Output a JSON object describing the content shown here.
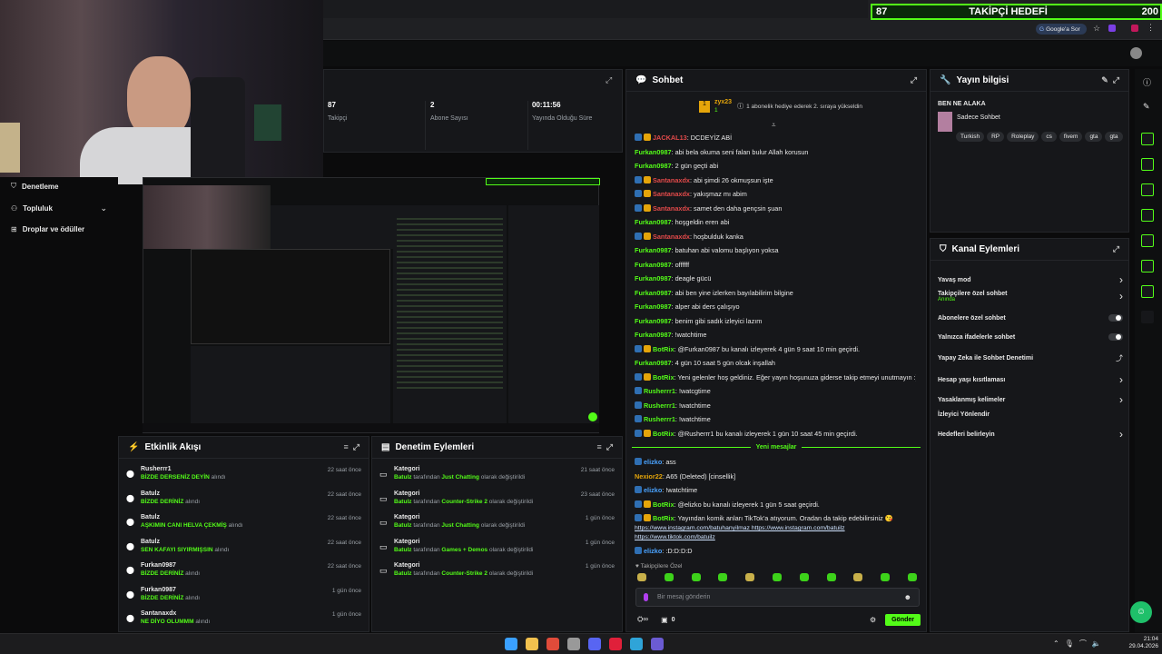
{
  "browser": {
    "goal_num": "87",
    "goal_title": "TAKİPÇİ HEDEFİ",
    "goal_max": "200",
    "google_btn": "Google'a Sor"
  },
  "stats": [
    {
      "value": "87",
      "label": "Takipçi"
    },
    {
      "value": "2",
      "label": "Abone Sayısı"
    },
    {
      "value": "00:11:56",
      "label": "Yayında Olduğu Süre"
    }
  ],
  "nav": {
    "items": [
      {
        "label": "Denetleme"
      },
      {
        "label": "Topluluk"
      },
      {
        "label": "Droplar ve ödüller"
      }
    ]
  },
  "chat": {
    "title": "Sohbet",
    "gifter": "zyx23",
    "gifter_count": "1",
    "gift_text": "1 abonelik hediye ederek 2. sıraya yükseldin",
    "lines": [
      {
        "user": "JACKAL13",
        "color": "#e24a4a",
        "text": ": DCDEYİZ ABİ",
        "badges": 2
      },
      {
        "user": "Furkan0987",
        "color": "#53fc18",
        "text": ": abi bela okuma seni falan bulur Allah korusun",
        "badges": 0
      },
      {
        "user": "Furkan0987",
        "color": "#53fc18",
        "text": ": 2 gün geçti abi",
        "badges": 0
      },
      {
        "user": "Santanaxdx",
        "color": "#e24a4a",
        "text": ": abi şimdi 26 okmuşsun işte",
        "badges": 2
      },
      {
        "user": "Santanaxdx",
        "color": "#e24a4a",
        "text": ": yakışmaz mı abim",
        "badges": 2
      },
      {
        "user": "Santanaxdx",
        "color": "#e24a4a",
        "text": ": samet den daha gençsin şuan",
        "badges": 2
      },
      {
        "user": "Furkan0987",
        "color": "#53fc18",
        "text": ": hoşgeldin eren abi",
        "badges": 0
      },
      {
        "user": "Santanaxdx",
        "color": "#e24a4a",
        "text": ": hoşbulduk kanka",
        "badges": 2
      },
      {
        "user": "Furkan0987",
        "color": "#53fc18",
        "text": ": batuhan abi valomu başlıyon yoksa",
        "badges": 0
      },
      {
        "user": "Furkan0987",
        "color": "#53fc18",
        "text": ": offffff",
        "badges": 0
      },
      {
        "user": "Furkan0987",
        "color": "#53fc18",
        "text": ": deagle gücü",
        "badges": 0
      },
      {
        "user": "Furkan0987",
        "color": "#53fc18",
        "text": ": abi ben yine izlerken bayılabilirim bilgine",
        "badges": 0
      },
      {
        "user": "Furkan0987",
        "color": "#53fc18",
        "text": ": alper abi ders çalışıyo",
        "badges": 0
      },
      {
        "user": "Furkan0987",
        "color": "#53fc18",
        "text": ": benim gibi sadık izleyici lazım",
        "badges": 0
      },
      {
        "user": "Furkan0987",
        "color": "#53fc18",
        "text": ": !watchtime",
        "badges": 0
      },
      {
        "user": "BotRix",
        "color": "#53fc18",
        "text": ": @Furkan0987 bu kanalı izleyerek 4 gün 9 saat 10 min geçirdi.",
        "badges": 2
      },
      {
        "user": "Furkan0987",
        "color": "#53fc18",
        "text": ": 4 gün 10 saat 5 gün olcak inşallah",
        "badges": 0
      },
      {
        "user": "BotRix",
        "color": "#53fc18",
        "text": ": Yeni gelenler hoş geldiniz. Eğer yayın hoşunuza giderse takip etmeyi unutmayın :)",
        "badges": 2
      },
      {
        "user": "Rusherrr1",
        "color": "#53fc18",
        "text": ": !watcgtime",
        "badges": 1
      },
      {
        "user": "Rusherrr1",
        "color": "#53fc18",
        "text": ": !watchtime",
        "badges": 1
      },
      {
        "user": "Rusherrr1",
        "color": "#53fc18",
        "text": ": !watchtime",
        "badges": 1
      },
      {
        "user": "BotRix",
        "color": "#53fc18",
        "text": ": @Rusherrr1 bu kanalı izleyerek 1 gün 10 saat 45 min geçirdi.",
        "badges": 2
      }
    ],
    "new_messages": "Yeni mesajlar",
    "lines2": [
      {
        "user": "elizko",
        "color": "#4aa3ff",
        "text": ": ass",
        "badges": 1
      },
      {
        "user": "Nexior22",
        "color": "#e5a50a",
        "text": ": A65 (Deleted) [cinsellik]",
        "badges": 0
      },
      {
        "user": "elizko",
        "color": "#4aa3ff",
        "text": ": !watchtime",
        "badges": 1
      },
      {
        "user": "BotRix",
        "color": "#53fc18",
        "text": ": @elizko bu kanalı izleyerek 1 gün 5 saat geçirdi.",
        "badges": 2
      },
      {
        "user": "BotRix",
        "color": "#53fc18",
        "text": ": Yayından komik anları TikTok'a atıyorum. Oradan da takip edebilirsiniz 😘",
        "badges": 2
      }
    ],
    "links": [
      "https://www.instagram.com/batuhanyilmaz https://www.instagram.com/batuilz",
      "https://www.tiktok.com/batuilz"
    ],
    "last": {
      "user": "elizko",
      "text": ": :D:D:D:D"
    },
    "followers_only": "Takipçilere Özel",
    "placeholder": "Bir mesaj gönderin",
    "count": "0",
    "send": "Gönder"
  },
  "stream_info": {
    "title": "Yayın bilgisi",
    "stream_title": "BEN NE ALAKA",
    "category": "Sadece Sohbet",
    "tags": [
      "Turkish",
      "RP",
      "Roleplay",
      "cs",
      "fivem",
      "gta",
      "gta"
    ]
  },
  "channel_actions": {
    "title": "Kanal Eylemleri",
    "items": [
      {
        "label": "Yavaş mod",
        "sub": "",
        "control": "chevron"
      },
      {
        "label": "Takipçilere özel sohbet",
        "sub": "Anında",
        "control": "chevron"
      },
      {
        "label": "Abonelere özel sohbet",
        "sub": "",
        "control": "toggle"
      },
      {
        "label": "Yalnızca ifadelerle sohbet",
        "sub": "",
        "control": "toggle"
      },
      {
        "label": "Yapay Zeka ile Sohbet Denetimi",
        "sub": "",
        "control": "ext"
      },
      {
        "label": "Hesap yaşı kısıtlaması",
        "sub": "",
        "control": "chevron"
      },
      {
        "label": "Yasaklanmış kelimeler",
        "sub": "",
        "control": "chevron"
      },
      {
        "label": "İzleyici Yönlendir",
        "sub": "",
        "control": "none"
      },
      {
        "label": "Hedefleri belirleyin",
        "sub": "",
        "control": "chevron"
      }
    ]
  },
  "activity": {
    "title": "Etkinlik Akışı",
    "events": [
      {
        "user": "Rusherrr1",
        "action": "BİZDE DERSENİZ DEYİN",
        "suffix": "alındı",
        "time": "22 saat önce"
      },
      {
        "user": "Batulz",
        "action": "BİZDE DERİNİZ",
        "suffix": "alındı",
        "time": "22 saat önce"
      },
      {
        "user": "Batulz",
        "action": "AŞKIMIN CANI HELVA ÇEKMİŞ",
        "suffix": "alındı",
        "time": "22 saat önce"
      },
      {
        "user": "Batulz",
        "action": "SEN KAFAYI SIYIRMIŞSIN",
        "suffix": "alındı",
        "time": "22 saat önce"
      },
      {
        "user": "Furkan0987",
        "action": "BİZDE DERİNİZ",
        "suffix": "alındı",
        "time": "22 saat önce"
      },
      {
        "user": "Furkan0987",
        "action": "BİZDE DERİNİZ",
        "suffix": "alındı",
        "time": "1 gün önce"
      },
      {
        "user": "Santanaxdx",
        "action": "NE DİYO OLUMMM",
        "suffix": "alındı",
        "time": "1 gün önce"
      }
    ]
  },
  "moderation": {
    "title": "Denetim Eylemleri",
    "events": [
      {
        "title": "Kategori",
        "by": "Batulz",
        "mid": "tarafından",
        "cat": "Just Chatting",
        "end": "olarak değiştirildi",
        "time": "21 saat önce"
      },
      {
        "title": "Kategori",
        "by": "Batulz",
        "mid": "tarafından",
        "cat": "Counter-Strike 2",
        "end": "olarak değiştirildi",
        "time": "23 saat önce"
      },
      {
        "title": "Kategori",
        "by": "Batulz",
        "mid": "tarafından",
        "cat": "Just Chatting",
        "end": "olarak değiştirildi",
        "time": "1 gün önce"
      },
      {
        "title": "Kategori",
        "by": "Batulz",
        "mid": "tarafından",
        "cat": "Games + Demos",
        "end": "olarak değiştirildi",
        "time": "1 gün önce"
      },
      {
        "title": "Kategori",
        "by": "Batulz",
        "mid": "tarafından",
        "cat": "Counter-Strike 2",
        "end": "olarak değiştirildi",
        "time": "1 gün önce"
      }
    ]
  },
  "taskbar": {
    "time": "21:04",
    "date": "29.04.2026"
  },
  "colors": {
    "accent": "#53fc18",
    "panel": "#16171a",
    "bg": "#0b0b0c"
  }
}
